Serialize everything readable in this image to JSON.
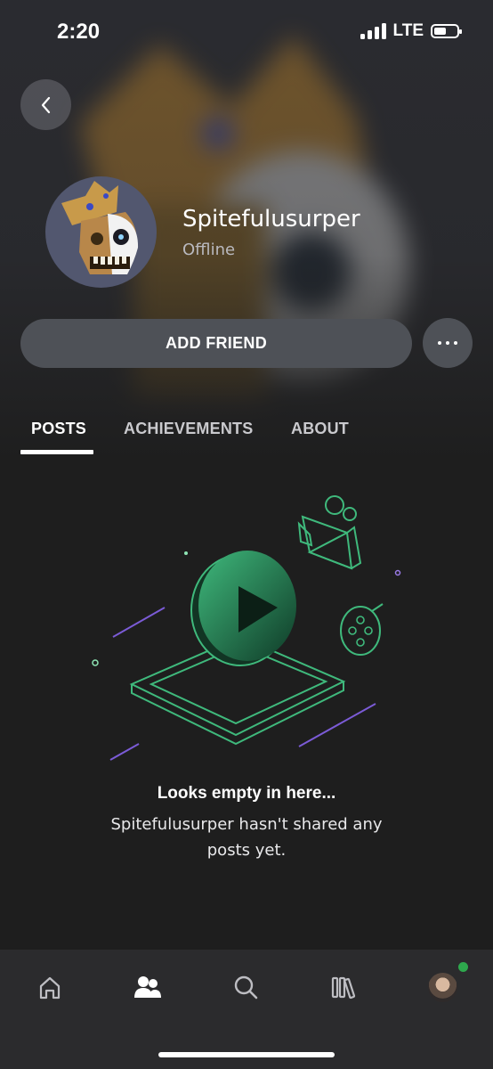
{
  "status_bar": {
    "time": "2:20",
    "network": "LTE"
  },
  "profile": {
    "gamertag": "Spitefulusurper",
    "presence": "Offline"
  },
  "actions": {
    "add_friend_label": "ADD FRIEND"
  },
  "tabs": [
    {
      "label": "POSTS",
      "active": true
    },
    {
      "label": "ACHIEVEMENTS",
      "active": false
    },
    {
      "label": "ABOUT",
      "active": false
    }
  ],
  "empty_state": {
    "title": "Looks empty in here...",
    "message": "Spitefulusurper hasn't shared any posts yet."
  },
  "bottom_nav": {
    "items": [
      {
        "icon": "home-icon",
        "active": false
      },
      {
        "icon": "friends-icon",
        "active": true
      },
      {
        "icon": "search-icon",
        "active": false
      },
      {
        "icon": "library-icon",
        "active": false
      },
      {
        "icon": "profile-avatar",
        "active": false
      }
    ]
  },
  "colors": {
    "background": "#1e1e1e",
    "button": "#4e5157",
    "accent_green": "#3fb97c",
    "accent_purple": "#7b5bd6",
    "online": "#2ea84d"
  }
}
